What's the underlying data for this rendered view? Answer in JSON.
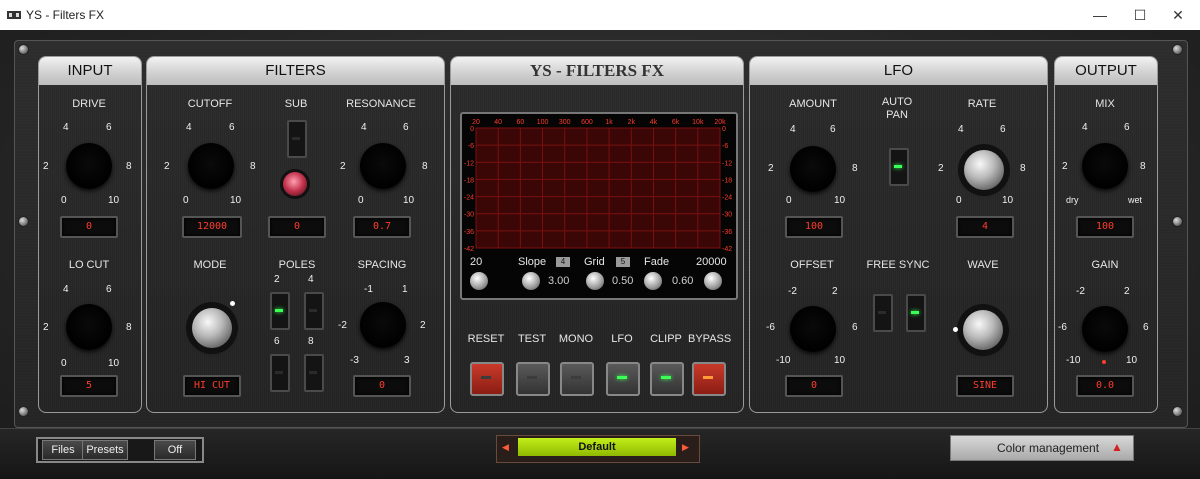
{
  "window": {
    "title": "YS - Filters FX",
    "minimize_glyph": "—",
    "maximize_glyph": "☐",
    "close_glyph": "✕"
  },
  "colors": {
    "led_red": "#ff3b2b",
    "led_green": "#3aff55",
    "preset_green": "#a3d100"
  },
  "input": {
    "header": "INPUT",
    "drive": {
      "label": "DRIVE",
      "value": "0",
      "ticks": [
        "0",
        "2",
        "4",
        "6",
        "8",
        "10"
      ]
    },
    "lo_cut": {
      "label": "LO CUT",
      "value": "5",
      "ticks": [
        "0",
        "2",
        "4",
        "6",
        "8",
        "10"
      ]
    }
  },
  "filters": {
    "header": "FILTERS",
    "cutoff": {
      "label": "CUTOFF",
      "value": "12000",
      "ticks": [
        "0",
        "2",
        "4",
        "6",
        "8",
        "10"
      ]
    },
    "sub": {
      "label": "SUB",
      "value": "0"
    },
    "resonance": {
      "label": "RESONANCE",
      "value": "0.7",
      "ticks": [
        "0",
        "2",
        "4",
        "6",
        "8",
        "10"
      ]
    },
    "mode": {
      "label": "MODE",
      "value": "HI CUT"
    },
    "poles": {
      "label": "POLES",
      "options": [
        "2",
        "4",
        "6",
        "8"
      ]
    },
    "spacing": {
      "label": "SPACING",
      "value": "0",
      "ticks": [
        "-3",
        "-2",
        "-1",
        "1",
        "2",
        "3"
      ]
    }
  },
  "center": {
    "header": "YS - FILTERS FX",
    "freq_ticks": [
      "20",
      "40",
      "60",
      "100",
      "300",
      "600",
      "1k",
      "2k",
      "4k",
      "6k",
      "10k",
      "20k"
    ],
    "db_ticks": [
      "0",
      "-6",
      "-12",
      "-18",
      "-24",
      "-30",
      "-36",
      "-42"
    ],
    "range_low": "20",
    "range_high": "20000",
    "slope": {
      "label": "Slope",
      "badge": "4",
      "value": "3.00"
    },
    "grid": {
      "label": "Grid",
      "badge": "5",
      "value": "0.50"
    },
    "fade": {
      "label": "Fade",
      "value": "0.60"
    },
    "buttons": [
      {
        "label": "RESET",
        "style": "red",
        "led": "off"
      },
      {
        "label": "TEST",
        "style": "gray",
        "led": "off"
      },
      {
        "label": "MONO",
        "style": "gray",
        "led": "off"
      },
      {
        "label": "LFO",
        "style": "gray",
        "led": "on"
      },
      {
        "label": "CLIPP",
        "style": "gray",
        "led": "on"
      },
      {
        "label": "BYPASS",
        "style": "red",
        "led": "orange"
      }
    ]
  },
  "lfo": {
    "header": "LFO",
    "amount": {
      "label": "AMOUNT",
      "value": "100",
      "ticks": [
        "0",
        "2",
        "4",
        "6",
        "8",
        "10"
      ]
    },
    "auto_pan": {
      "label": "AUTO\nPAN"
    },
    "rate": {
      "label": "RATE",
      "value": "4",
      "ticks": [
        "0",
        "2",
        "4",
        "6",
        "8",
        "10"
      ]
    },
    "offset": {
      "label": "OFFSET",
      "value": "0",
      "ticks": [
        "-10",
        "-6",
        "-2",
        "2",
        "6",
        "10"
      ]
    },
    "free_sync": {
      "label": "FREE SYNC"
    },
    "wave": {
      "label": "WAVE",
      "value": "SINE"
    }
  },
  "output": {
    "header": "OUTPUT",
    "mix": {
      "label": "MIX",
      "value": "100",
      "ticks": [
        "2",
        "4",
        "6",
        "8"
      ],
      "dry": "dry",
      "wet": "wet"
    },
    "gain": {
      "label": "GAIN",
      "value": "0.0",
      "ticks": [
        "-10",
        "-6",
        "-2",
        "2",
        "6",
        "10"
      ]
    }
  },
  "bottom": {
    "files": "Files",
    "presets": "Presets",
    "off": "Off",
    "preset_name": "Default",
    "prev_glyph": "◀",
    "next_glyph": "▶",
    "color_management": "Color management",
    "cm_glyph": "▲"
  }
}
